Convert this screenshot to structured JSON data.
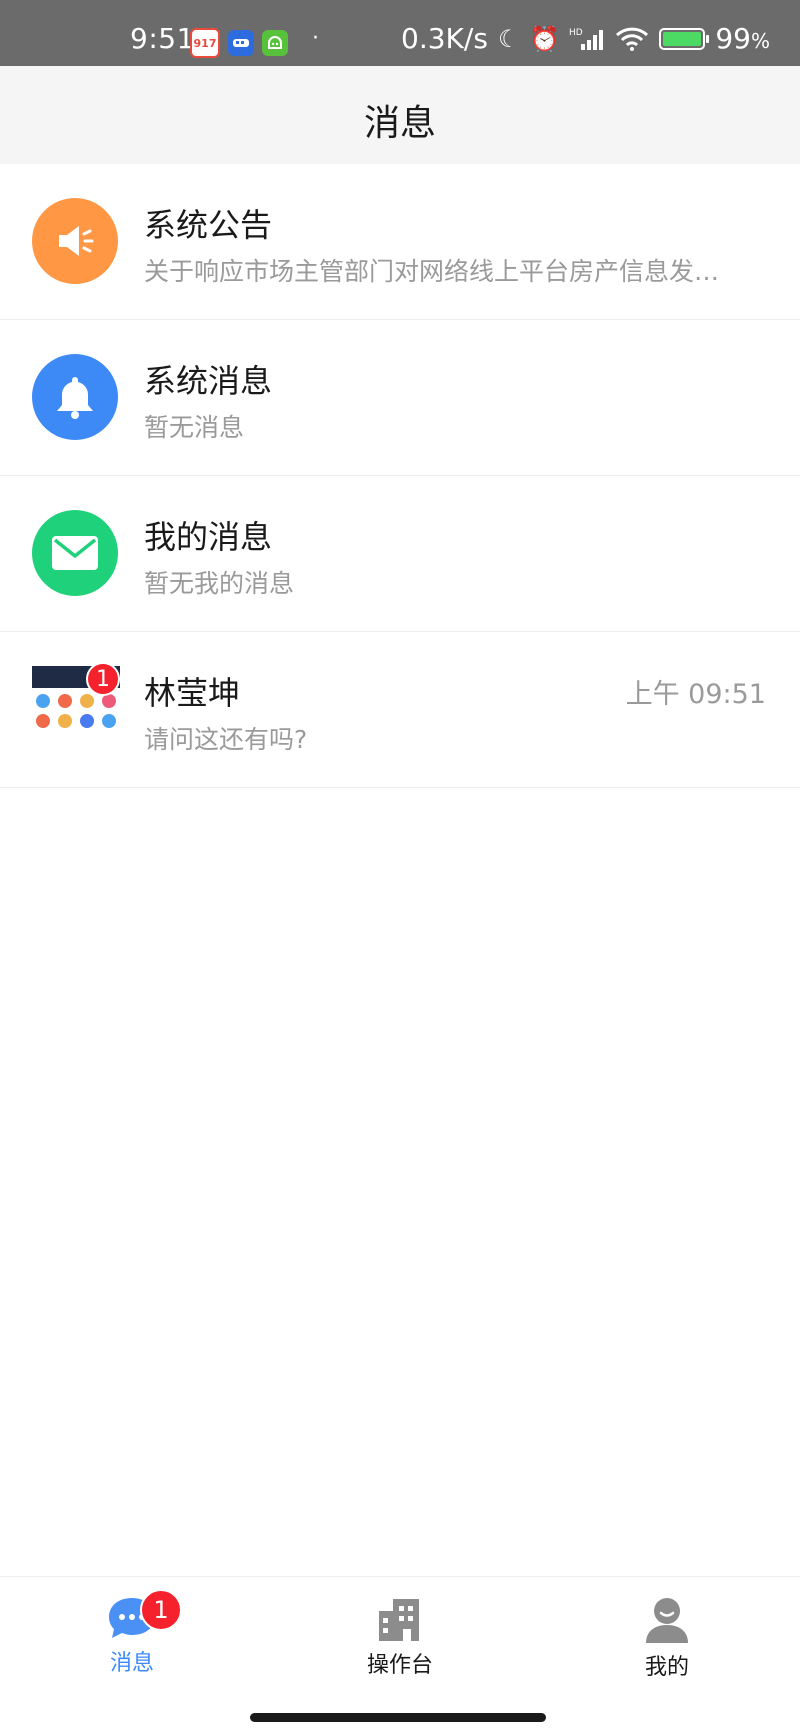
{
  "status_bar": {
    "time": "9:51",
    "app_icons": [
      {
        "name": "app-917-icon",
        "label": "917",
        "color": "#e84a3c"
      },
      {
        "name": "app-train-icon",
        "label": "",
        "color": "#2d6cdf"
      },
      {
        "name": "app-android-icon",
        "label": "",
        "color": "#57c13b"
      }
    ],
    "dot": "·",
    "net_speed": "0.3K/s",
    "battery": "99",
    "battery_unit": "%",
    "battery_level": 0.99
  },
  "header": {
    "title": "消息"
  },
  "messages": [
    {
      "title": "系统公告",
      "subtitle": "关于响应市场主管部门对网络线上平台房产信息发…",
      "icon": "speaker-icon",
      "color": "#ff9745"
    },
    {
      "title": "系统消息",
      "subtitle": "暂无消息",
      "icon": "bell-icon",
      "color": "#3d8af7"
    },
    {
      "title": "我的消息",
      "subtitle": "暂无我的消息",
      "icon": "envelope-icon",
      "color": "#1fd17a"
    },
    {
      "title": "林莹坤",
      "subtitle": "请问这还有吗?",
      "time": "上午 09:51",
      "badge": "1"
    }
  ],
  "tabbar": {
    "tabs": [
      {
        "label": "消息",
        "icon": "chat-bubble-icon",
        "active": true,
        "badge": "1"
      },
      {
        "label": "操作台",
        "icon": "building-icon",
        "active": false
      },
      {
        "label": "我的",
        "icon": "user-icon",
        "active": false
      }
    ],
    "active_color": "#3d8af7"
  }
}
